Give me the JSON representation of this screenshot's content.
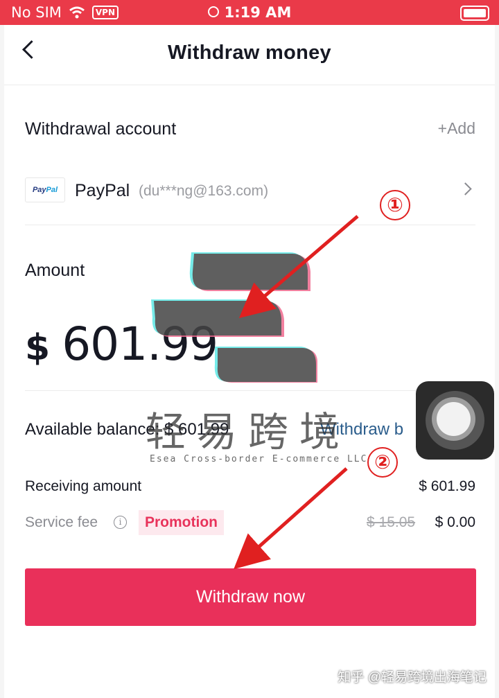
{
  "status_bar": {
    "carrier": "No SIM",
    "vpn": "VPN",
    "time": "1:19 AM"
  },
  "header": {
    "title": "Withdraw money"
  },
  "account": {
    "label": "Withdrawal account",
    "add_label": "+Add",
    "method_name": "PayPal",
    "method_email": "(du***ng@163.com)",
    "logo_text_1": "Pay",
    "logo_text_2": "Pal"
  },
  "amount": {
    "label": "Amount",
    "currency": "$",
    "value": "601.99"
  },
  "balance": {
    "text": "Available balance: $ 601.99",
    "withdraw_all": "Withdraw b"
  },
  "summary": {
    "receiving_label": "Receiving amount",
    "receiving_value": "$ 601.99",
    "fee_label": "Service fee",
    "promotion": "Promotion",
    "fee_original": "$ 15.05",
    "fee_value": "$ 0.00"
  },
  "button": {
    "label": "Withdraw now"
  },
  "annotations": {
    "marker_1": "①",
    "marker_2": "②",
    "arrow_color": "#e02020"
  },
  "watermark": {
    "cn": "轻易跨境",
    "en": "Esea Cross-border E-commerce LLC",
    "source": "知乎 @轻易跨境出海笔记"
  },
  "colors": {
    "status_bar": "#ea3a49",
    "primary": "#e9305a",
    "link": "#2b5d8c",
    "promotion_bg": "#fde9ee"
  }
}
